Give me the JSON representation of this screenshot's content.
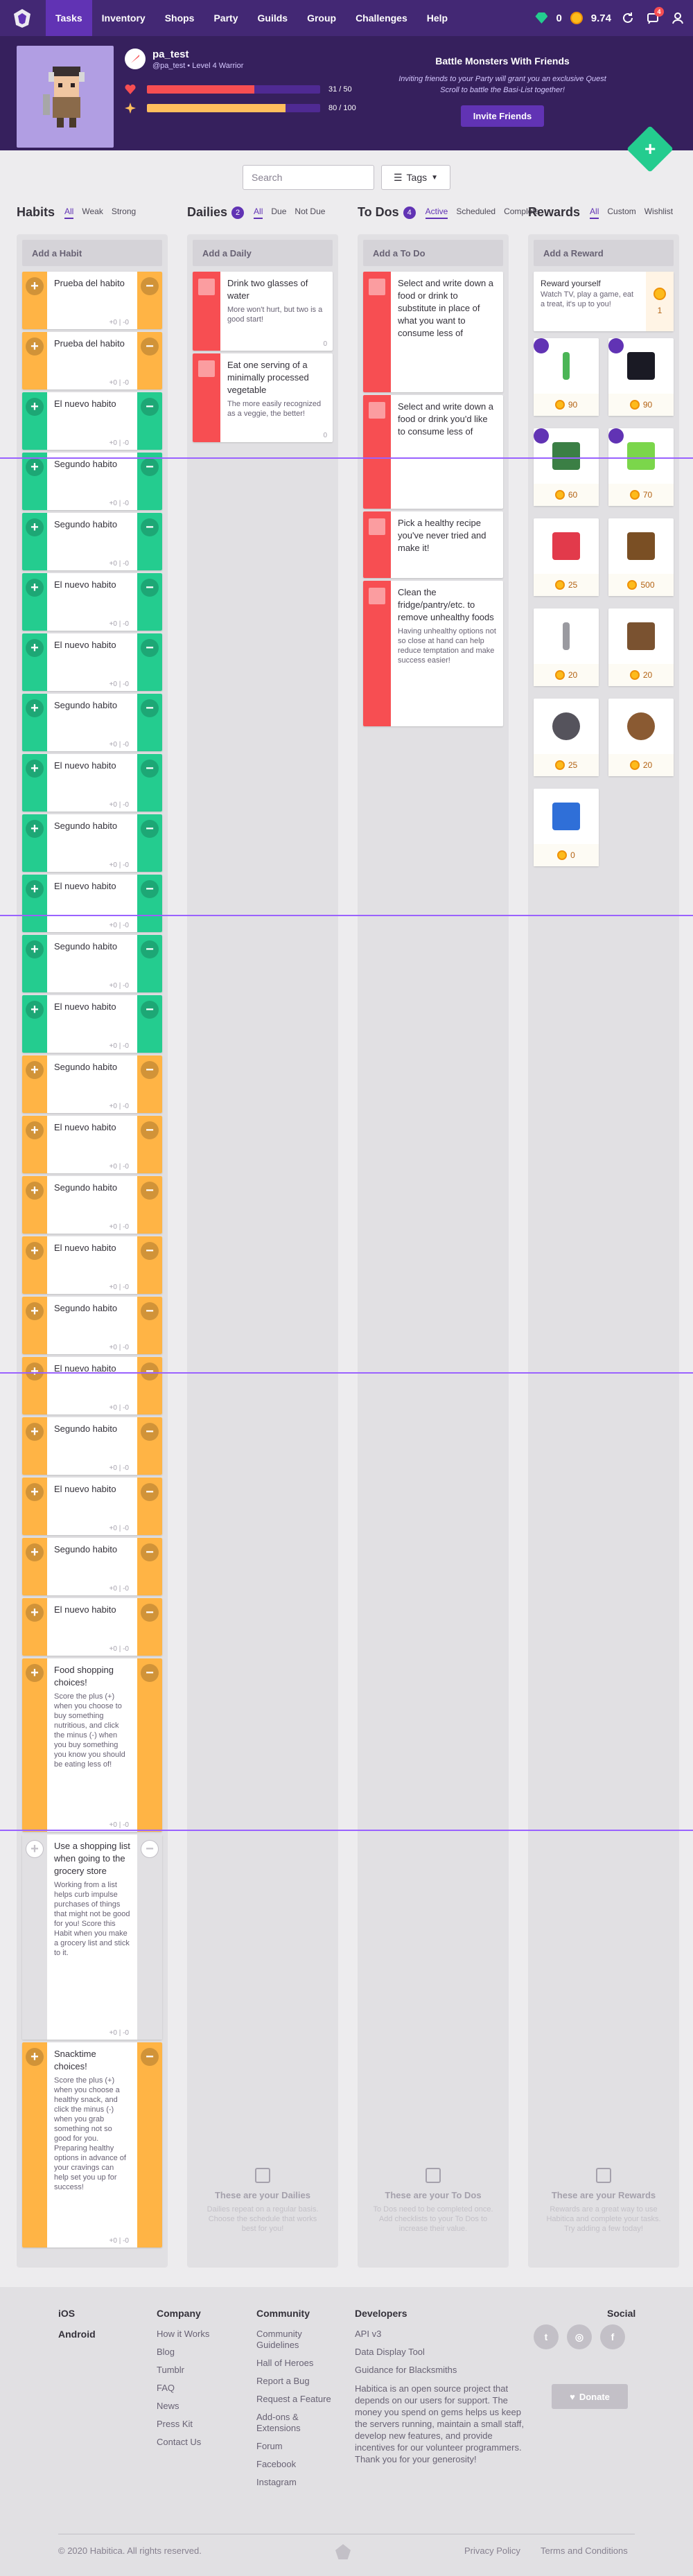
{
  "nav": {
    "items": [
      "Tasks",
      "Inventory",
      "Shops",
      "Party",
      "Guilds",
      "Group",
      "Challenges",
      "Help"
    ],
    "gems": "0",
    "gold": "9.74",
    "notif_count": "4"
  },
  "header": {
    "username": "pa_test",
    "subtitle": "@pa_test • Level 4 Warrior",
    "hp_text": "31 / 50",
    "hp_fraction": 0.62,
    "xp_text": "80 / 100",
    "xp_fraction": 0.8,
    "hp_color": "#f74e52",
    "xp_color": "#ffbe5d",
    "party_title": "Battle Monsters With Friends",
    "party_text": "Inviting friends to your Party will grant you an exclusive Quest Scroll to battle the Basi-List together!",
    "invite_label": "Invite Friends"
  },
  "toolbar": {
    "search_placeholder": "Search",
    "tags_label": "Tags"
  },
  "habits": {
    "title": "Habits",
    "filters": [
      "All",
      "Weak",
      "Strong"
    ],
    "add_label": "Add a Habit",
    "meta": "+0 | -0",
    "items": [
      {
        "text": "Prueba del habito",
        "color": "#ffb445"
      },
      {
        "text": "Prueba del habito",
        "color": "#ffb445"
      },
      {
        "text": "El nuevo habito",
        "color": "#24cc8f"
      },
      {
        "text": "Segundo habito",
        "color": "#24cc8f"
      },
      {
        "text": "Segundo habito",
        "color": "#24cc8f"
      },
      {
        "text": "El nuevo habito",
        "color": "#24cc8f"
      },
      {
        "text": "El nuevo habito",
        "color": "#24cc8f"
      },
      {
        "text": "Segundo habito",
        "color": "#24cc8f"
      },
      {
        "text": "El nuevo habito",
        "color": "#24cc8f"
      },
      {
        "text": "Segundo habito",
        "color": "#24cc8f"
      },
      {
        "text": "El nuevo habito",
        "color": "#24cc8f"
      },
      {
        "text": "Segundo habito",
        "color": "#24cc8f"
      },
      {
        "text": "El nuevo habito",
        "color": "#24cc8f"
      },
      {
        "text": "Segundo habito",
        "color": "#ffb445"
      },
      {
        "text": "El nuevo habito",
        "color": "#ffb445"
      },
      {
        "text": "Segundo habito",
        "color": "#ffb445"
      },
      {
        "text": "El nuevo habito",
        "color": "#ffb445"
      },
      {
        "text": "Segundo habito",
        "color": "#ffb445"
      },
      {
        "text": "El nuevo habito",
        "color": "#ffb445"
      },
      {
        "text": "Segundo habito",
        "color": "#ffb445"
      },
      {
        "text": "El nuevo habito",
        "color": "#ffb445"
      },
      {
        "text": "Segundo habito",
        "color": "#ffb445"
      },
      {
        "text": "El nuevo habito",
        "color": "#ffb445"
      }
    ],
    "food": {
      "title": "Food shopping choices!",
      "notes": "Score the plus (+) when you choose to buy something nutritious, and click the minus (-) when you buy something you know you should be eating less of!"
    },
    "list": {
      "title": "Use a shopping list when going to the grocery store",
      "notes": "Working from a list helps curb impulse purchases of things that might not be good for you! Score this Habit when you make a grocery list and stick to it."
    },
    "snack": {
      "title": "Snacktime choices!",
      "notes": "Score the plus (+) when you choose a healthy snack, and click the minus (-) when you grab something not so good for you. Preparing healthy options in advance of your cravings can help set you up for success!"
    }
  },
  "dailies": {
    "title": "Dailies",
    "badge": "2",
    "filters": [
      "All",
      "Due",
      "Not Due"
    ],
    "add_label": "Add a Daily",
    "items": [
      {
        "title": "Drink two glasses of water",
        "notes": "More won't hurt, but two is a good start!",
        "meta": "0"
      },
      {
        "title": "Eat one serving of a minimally processed vegetable",
        "notes": "The more easily recognized as a veggie, the better!",
        "meta": "0"
      }
    ],
    "empty_title": "These are your Dailies",
    "empty_text": "Dailies repeat on a regular basis. Choose the schedule that works best for you!"
  },
  "todos": {
    "title": "To Dos",
    "badge": "4",
    "filters": [
      "Active",
      "Scheduled",
      "Complete"
    ],
    "add_label": "Add a To Do",
    "items": [
      {
        "title": "Select and write down a food or drink to substitute in place of what you want to consume less of",
        "notes": ""
      },
      {
        "title": "Select and write down a food or drink you'd like to consume less of",
        "notes": ""
      },
      {
        "title": "Pick a healthy recipe you've never tried and make it!",
        "notes": ""
      },
      {
        "title": "Clean the fridge/pantry/etc. to remove unhealthy foods",
        "notes": "Having unhealthy options not so close at hand can help reduce temptation and make success easier!"
      }
    ],
    "empty_title": "These are your To Dos",
    "empty_text": "To Dos need to be completed once. Add checklists to your To Dos to increase their value."
  },
  "rewards": {
    "title": "Rewards",
    "filters": [
      "All",
      "Custom",
      "Wishlist"
    ],
    "add_label": "Add a Reward",
    "custom": {
      "title": "Reward yourself",
      "notes": "Watch TV, play a game, eat a treat, it's up to you!",
      "price": "1"
    },
    "items": [
      {
        "name": "sword",
        "price": "90",
        "color": "#4bb556"
      },
      {
        "name": "wolf",
        "price": "90",
        "color": "#1a1a24"
      },
      {
        "name": "shield-green",
        "price": "60",
        "color": "#3b7f45"
      },
      {
        "name": "gem-green",
        "price": "70",
        "color": "#7bd64b"
      },
      {
        "name": "health-potion",
        "price": "25",
        "color": "#e23a4b"
      },
      {
        "name": "chest",
        "price": "500",
        "color": "#7a4f24"
      },
      {
        "name": "dagger",
        "price": "20",
        "color": "#9a9aa0"
      },
      {
        "name": "armor",
        "price": "20",
        "color": "#7a5230"
      },
      {
        "name": "helm",
        "price": "25",
        "color": "#55535c"
      },
      {
        "name": "egg",
        "price": "20",
        "color": "#8a5a32"
      },
      {
        "name": "shield-blue",
        "price": "0",
        "color": "#2f6fd8"
      }
    ],
    "empty_title": "These are your Rewards",
    "empty_text": "Rewards are a great way to use Habitica and complete your tasks. Try adding a few today!"
  },
  "footer": {
    "col1": [
      "iOS",
      "Android"
    ],
    "company_title": "Company",
    "company": [
      "How it Works",
      "Blog",
      "Tumblr",
      "FAQ",
      "News",
      "Press Kit",
      "Contact Us"
    ],
    "community_title": "Community",
    "community": [
      "Community Guidelines",
      "Hall of Heroes",
      "Report a Bug",
      "Request a Feature",
      "Add-ons & Extensions",
      "Forum",
      "Facebook",
      "Instagram"
    ],
    "dev_title": "Developers",
    "dev": [
      "API v3",
      "Data Display Tool",
      "Guidance for Blacksmiths"
    ],
    "dev_text": "Habitica is an open source project that depends on our users for support. The money you spend on gems helps us keep the servers running, maintain a small staff, develop new features, and provide incentives for our volunteer programmers. Thank you for your generosity!",
    "social_title": "Social",
    "donate": "Donate",
    "copyright": "© 2020 Habitica. All rights reserved.",
    "privacy": "Privacy Policy",
    "terms": "Terms and Conditions"
  }
}
